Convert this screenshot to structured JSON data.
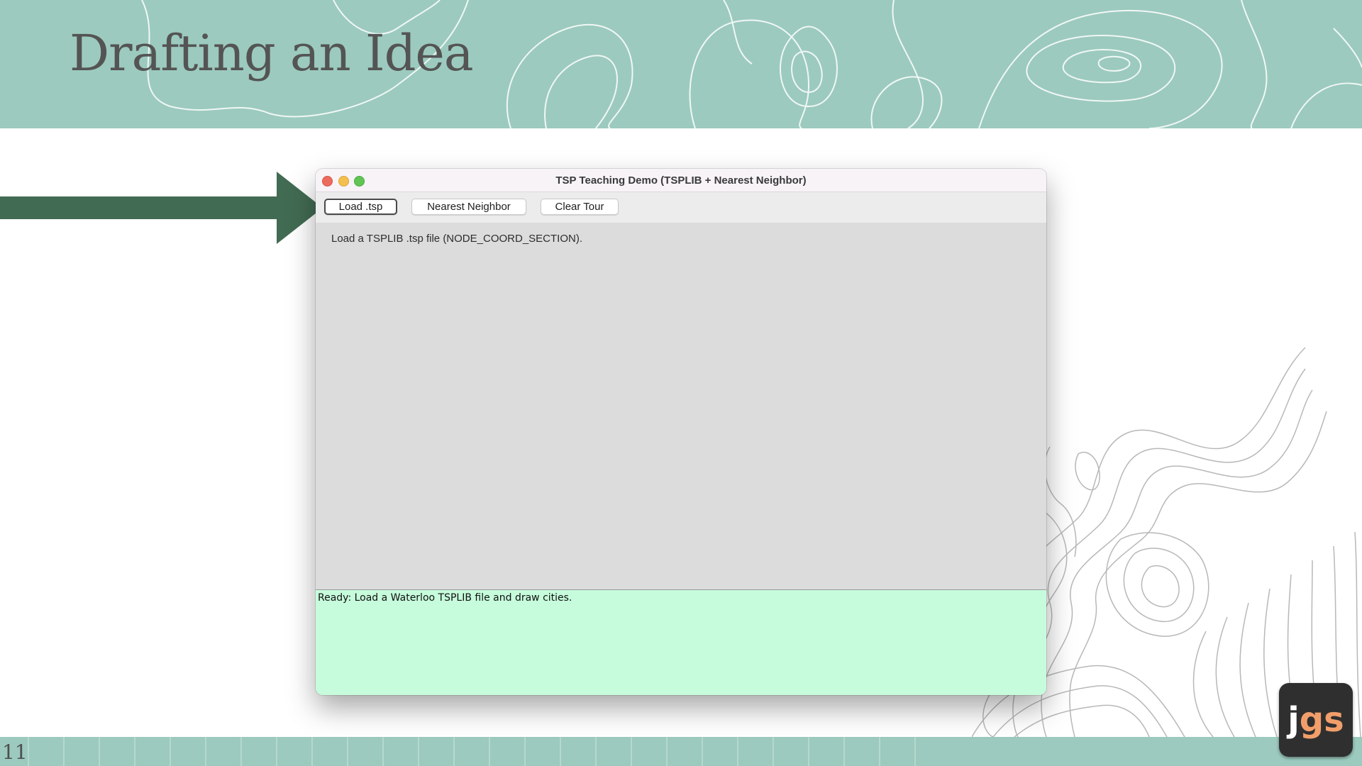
{
  "slide": {
    "title": "Drafting an Idea",
    "number": "11"
  },
  "logo": {
    "letter_j": "j",
    "letters_gs": "gs",
    "accent_color": "#f29e6a"
  },
  "colors": {
    "band": "#9ccabe",
    "arrow": "#426b53",
    "status_bg": "#c6fcdc"
  },
  "window": {
    "title": "TSP Teaching Demo (TSPLIB + Nearest Neighbor)",
    "toolbar": {
      "load_label": "Load .tsp",
      "nearest_label": "Nearest Neighbor",
      "clear_label": "Clear Tour"
    },
    "canvas_hint": "Load a TSPLIB .tsp file (NODE_COORD_SECTION).",
    "status": "Ready: Load a Waterloo TSPLIB file and draw cities."
  }
}
